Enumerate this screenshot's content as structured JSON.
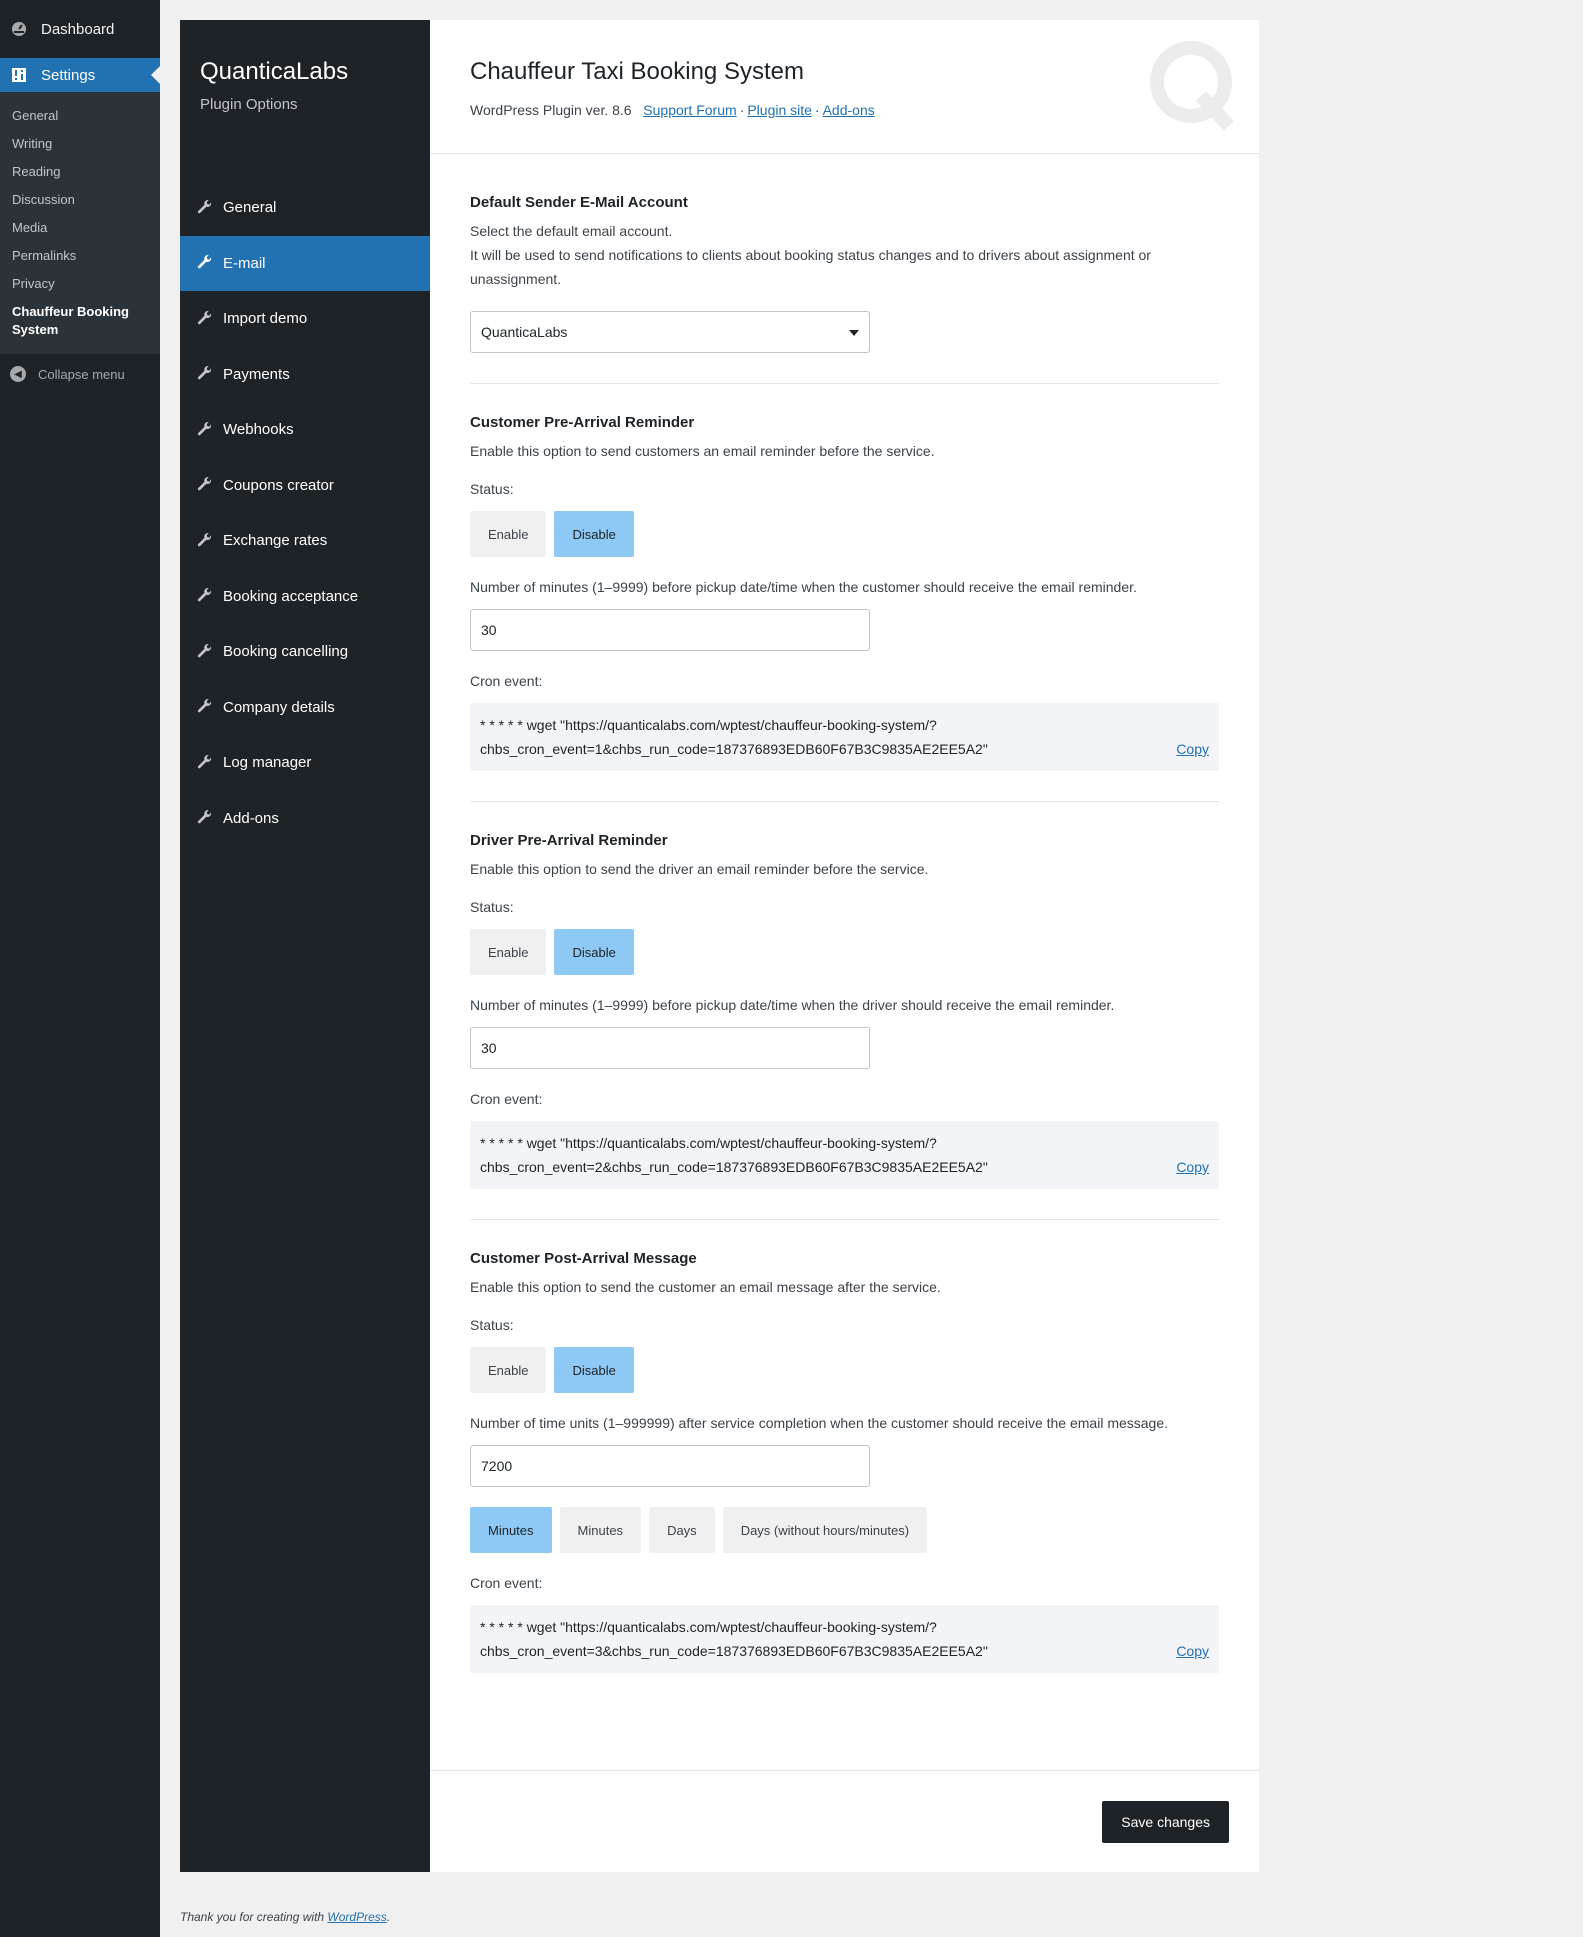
{
  "wp_menu": {
    "dashboard": "Dashboard",
    "settings": "Settings",
    "submenu": [
      "General",
      "Writing",
      "Reading",
      "Discussion",
      "Media",
      "Permalinks",
      "Privacy",
      "Chauffeur Booking System"
    ],
    "collapse": "Collapse menu"
  },
  "plugin_nav": {
    "brand": "QuanticaLabs",
    "subtitle": "Plugin Options",
    "items": [
      "General",
      "E-mail",
      "Import demo",
      "Payments",
      "Webhooks",
      "Coupons creator",
      "Exchange rates",
      "Booking acceptance",
      "Booking cancelling",
      "Company details",
      "Log manager",
      "Add-ons"
    ],
    "active": "E-mail"
  },
  "header": {
    "title": "Chauffeur Taxi Booking System",
    "version": "WordPress Plugin ver. 8.6",
    "links": [
      "Support Forum",
      "Plugin site",
      "Add-ons"
    ],
    "separator": "·"
  },
  "sender": {
    "title": "Default Sender E-Mail Account",
    "desc1": "Select the default email account.",
    "desc2": "It will be used to send notifications to clients about booking status changes and to drivers about assignment or unassignment.",
    "selected": "QuanticaLabs"
  },
  "customer_reminder": {
    "title": "Customer Pre-Arrival Reminder",
    "desc": "Enable this option to send customers an email reminder before the service.",
    "status_label": "Status:",
    "enable": "Enable",
    "disable": "Disable",
    "minutes_label": "Number of minutes (1–9999) before pickup date/time when the customer should receive the email reminder.",
    "minutes_value": "30",
    "cron_label": "Cron event:",
    "cron_line1": "* * * * * wget \"https://quanticalabs.com/wptest/chauffeur-booking-system/?",
    "cron_line2": "chbs_cron_event=1&chbs_run_code=187376893EDB60F67B3C9835AE2EE5A2\"",
    "copy": "Copy"
  },
  "driver_reminder": {
    "title": "Driver Pre-Arrival Reminder",
    "desc": "Enable this option to send the driver an email reminder before the service.",
    "status_label": "Status:",
    "enable": "Enable",
    "disable": "Disable",
    "minutes_label": "Number of minutes (1–9999) before pickup date/time when the driver should receive the email reminder.",
    "minutes_value": "30",
    "cron_label": "Cron event:",
    "cron_line1": "* * * * * wget \"https://quanticalabs.com/wptest/chauffeur-booking-system/?",
    "cron_line2": "chbs_cron_event=2&chbs_run_code=187376893EDB60F67B3C9835AE2EE5A2\"",
    "copy": "Copy"
  },
  "customer_post": {
    "title": "Customer Post-Arrival Message",
    "desc": "Enable this option to send the customer an email message after the service.",
    "status_label": "Status:",
    "enable": "Enable",
    "disable": "Disable",
    "units_label": "Number of time units (1–999999) after service completion when the customer should receive the email message.",
    "units_value": "7200",
    "unit_options": [
      "Minutes",
      "Minutes",
      "Days",
      "Days (without hours/minutes)"
    ],
    "cron_label": "Cron event:",
    "cron_line1": "* * * * * wget \"https://quanticalabs.com/wptest/chauffeur-booking-system/?",
    "cron_line2": "chbs_cron_event=3&chbs_run_code=187376893EDB60F67B3C9835AE2EE5A2\"",
    "copy": "Copy"
  },
  "save_label": "Save changes",
  "footer": {
    "text": "Thank you for creating with ",
    "link": "WordPress",
    "end": "."
  }
}
